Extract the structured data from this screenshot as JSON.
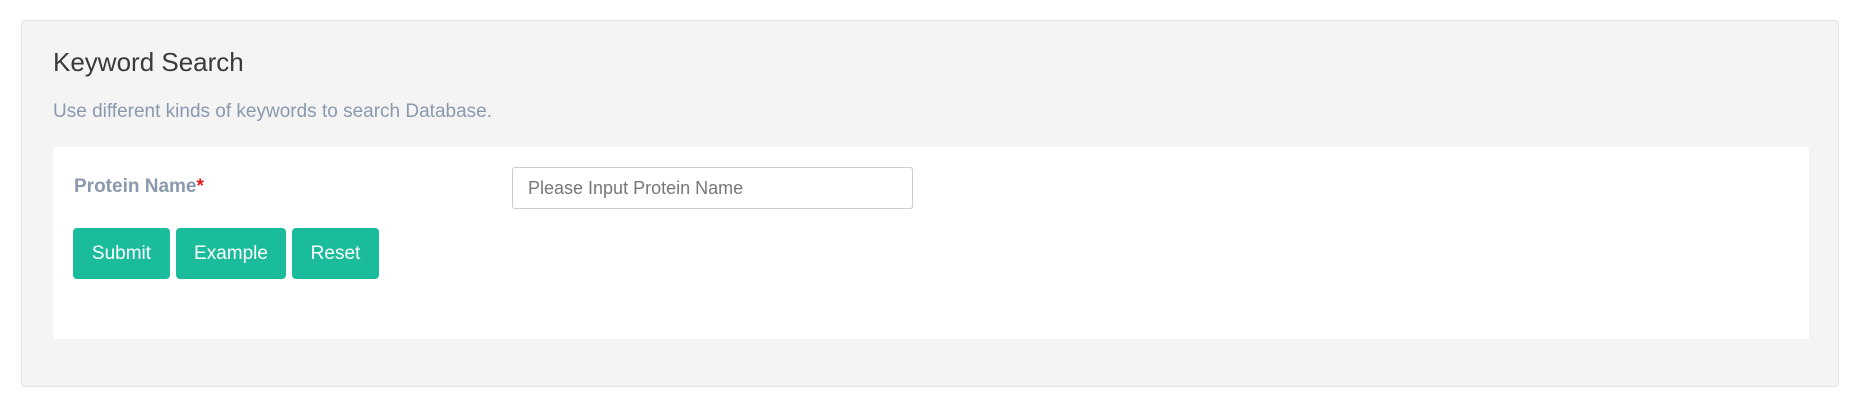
{
  "panel": {
    "title": "Keyword Search",
    "description": "Use different kinds of keywords to search Database."
  },
  "form": {
    "protein_name": {
      "label": "Protein Name",
      "required_marker": "*",
      "value": "",
      "placeholder": "Please Input Protein Name"
    },
    "buttons": {
      "submit_label": "Submit",
      "example_label": "Example",
      "reset_label": "Reset"
    }
  },
  "colors": {
    "button_bg": "#1abc9c",
    "label_color": "#8a99ad",
    "required_color": "#e3181d",
    "panel_bg": "#f4f4f4"
  }
}
